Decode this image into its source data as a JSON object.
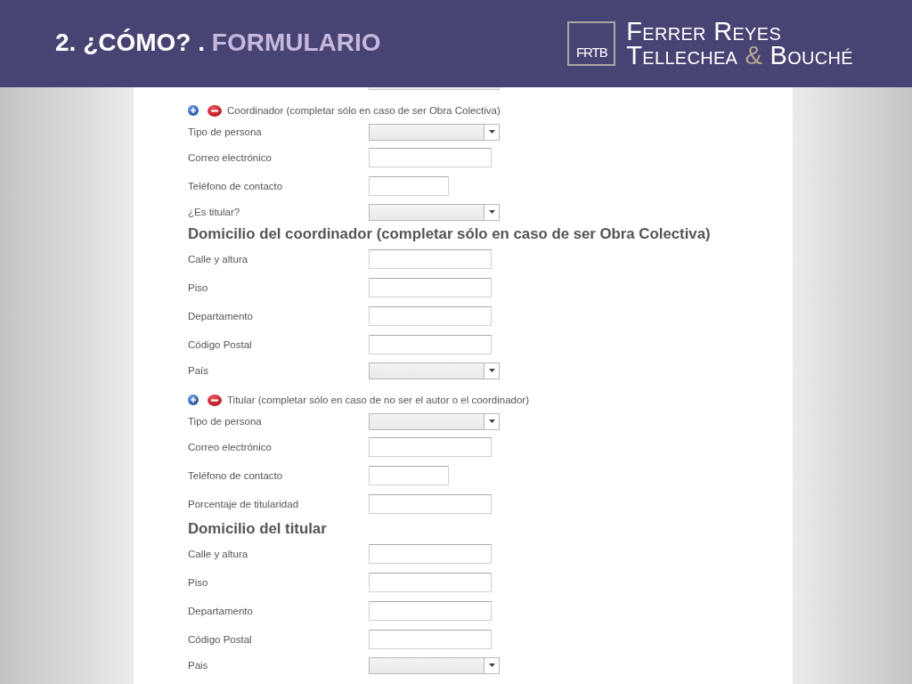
{
  "header": {
    "title": {
      "text": "2. ¿CÓMO? .",
      "highlight": "FORMULARIO"
    },
    "logo": {
      "monogram": "FRTB",
      "line_1": "Ferrer Reyes",
      "line_2_start": "Tellechea",
      "connector": "&",
      "line_2_end": "Bouché"
    }
  },
  "form": {
    "cut_off_field": {
      "kind": "select"
    },
    "blocks": [
      {
        "kind": "group",
        "title": "Coordinador (completar sólo en caso de ser Obra Colectiva)",
        "fields": [
          {
            "label": "Tipo de persona",
            "kind": "select"
          },
          {
            "label": "Correo electrónico",
            "kind": "text"
          },
          {
            "label": "Teléfono de contacto",
            "kind": "short_text"
          },
          {
            "label": "¿Es titular?",
            "kind": "select"
          }
        ]
      },
      {
        "kind": "heading",
        "title": "Domicilio del coordinador (completar sólo en caso de ser Obra Colectiva)",
        "fields": [
          {
            "label": "Calle y altura",
            "kind": "text"
          },
          {
            "label": "Piso",
            "kind": "text"
          },
          {
            "label": "Departamento",
            "kind": "text"
          },
          {
            "label": "Código Postal",
            "kind": "text"
          },
          {
            "label": "País",
            "kind": "select"
          }
        ]
      },
      {
        "kind": "group",
        "title": "Titular (completar sólo en caso de no ser el autor o el coordinador)",
        "fields": [
          {
            "label": "Tipo de persona",
            "kind": "select"
          },
          {
            "label": "Correo electrónico",
            "kind": "text"
          },
          {
            "label": "Teléfono de contacto",
            "kind": "short_text"
          },
          {
            "label": "Porcentaje de titularidad",
            "kind": "text"
          }
        ]
      },
      {
        "kind": "heading",
        "title": "Domicilio del titular",
        "fields": [
          {
            "label": "Calle y altura",
            "kind": "text"
          },
          {
            "label": "Piso",
            "kind": "text"
          },
          {
            "label": "Departamento",
            "kind": "text"
          },
          {
            "label": "Código Postal",
            "kind": "text"
          },
          {
            "label": "Pais",
            "kind": "select"
          }
        ]
      }
    ]
  }
}
